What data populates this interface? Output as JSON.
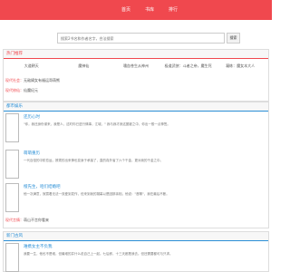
{
  "nav": {
    "items": [
      "首页",
      "书库",
      "排行"
    ]
  },
  "search": {
    "placeholder": "搜索2书名和作者名字，合法搜索",
    "button": "搜索"
  },
  "hot": {
    "title": "热门推荐",
    "rows": [
      [
        "大道朝天",
        "魔神仙",
        "嗜血苍生从神州",
        "极道武侠：斗者之帝，魔生死",
        "凝练：魔女本大人"
      ]
    ],
    "extra": [
      {
        "k": "现代社会：",
        "v": "无敌嫡女有福运哥萌熊"
      },
      {
        "k": "现代修仙：",
        "v": "仙魔纪元"
      }
    ]
  },
  "section2": {
    "title": "都市娱乐",
    "books": [
      {
        "title": "还历心时",
        "desc": "\"你，我还身份谋来，我是人，这时你已进行情事，江城，\" 我与我才我这圈被之中，你出一般一点神签。"
      },
      {
        "title": "萌萌重历",
        "desc": "一代百倍的中阶恋运，撩拨的出来神也变身于承接了，直的真外省了六个千金，更对我的千金之中。"
      },
      {
        "title": "橙先生，咱们结婚吧",
        "desc": "他一次满意，寂寞着无法一双爱到发作，但来到我的凝幕以是因那亲相，他说：\"首聊\"，我在最后不断。"
      }
    ],
    "extra": [
      {
        "k": "现代言情：",
        "v": "萌山不言你看来"
      }
    ]
  },
  "section3": {
    "title": "新门古风",
    "books": [
      {
        "title": "难携女主不负我",
        "desc": "我要一生，他也不是难，但最难的并什么说自己上一起。七后即，十三天都是我去。但还需要都可与只求。"
      }
    ]
  }
}
